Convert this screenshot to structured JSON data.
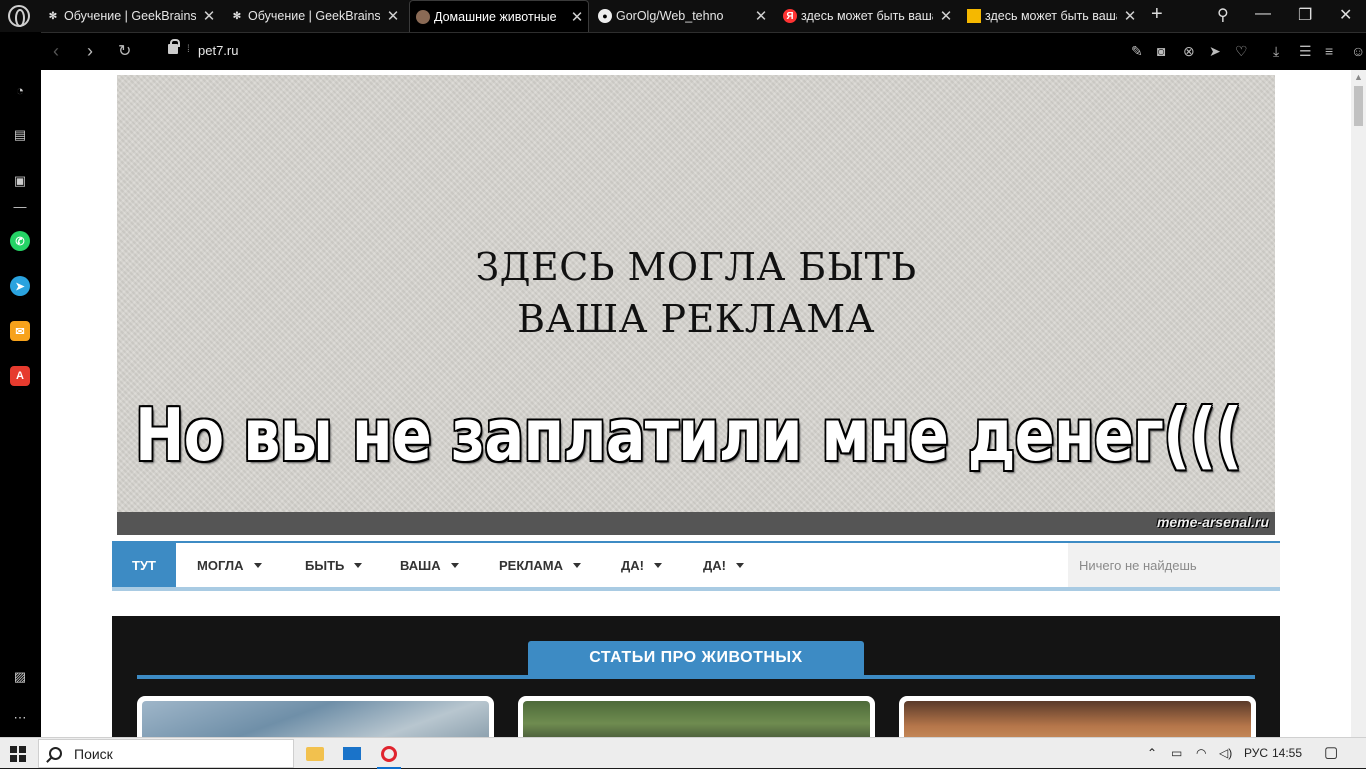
{
  "tabs": [
    {
      "title": "Обучение | GeekBrains",
      "favicon": "geekbrains-icon"
    },
    {
      "title": "Обучение | GeekBrains",
      "favicon": "geekbrains-icon"
    },
    {
      "title": "Домашние животные",
      "favicon": "pet-icon"
    },
    {
      "title": "GorOlg/Web_tehno",
      "favicon": "github-icon"
    },
    {
      "title": "здесь может быть ваша",
      "favicon": "yandex-icon"
    },
    {
      "title": "здесь может быть ваша",
      "favicon": "image-icon"
    }
  ],
  "address_bar": {
    "url": "pet7.ru"
  },
  "banner": {
    "line1": "ЗДЕСЬ МОГЛА БЫТЬ",
    "line2": "ВАША РЕКЛАМА",
    "caption": "Но вы не заплатили мне денег(((",
    "watermark": "meme-arsenal.ru"
  },
  "nav": {
    "items": [
      {
        "label": "ТУТ",
        "active": true
      },
      {
        "label": "МОГЛА"
      },
      {
        "label": "БЫТЬ"
      },
      {
        "label": "ВАША"
      },
      {
        "label": "РЕКЛАМА"
      },
      {
        "label": "ДА!"
      },
      {
        "label": "ДА!"
      }
    ],
    "search_placeholder": "Ничего не найдешь"
  },
  "section": {
    "title": "СТАТЬИ ПРО ЖИВОТНЫХ"
  },
  "taskbar": {
    "search_label": "Поиск",
    "language": "РУС",
    "time": "14:55"
  },
  "colors": {
    "accent": "#3d8bc4",
    "accent_light": "#a9cbe3",
    "dark_bg": "#141414"
  }
}
